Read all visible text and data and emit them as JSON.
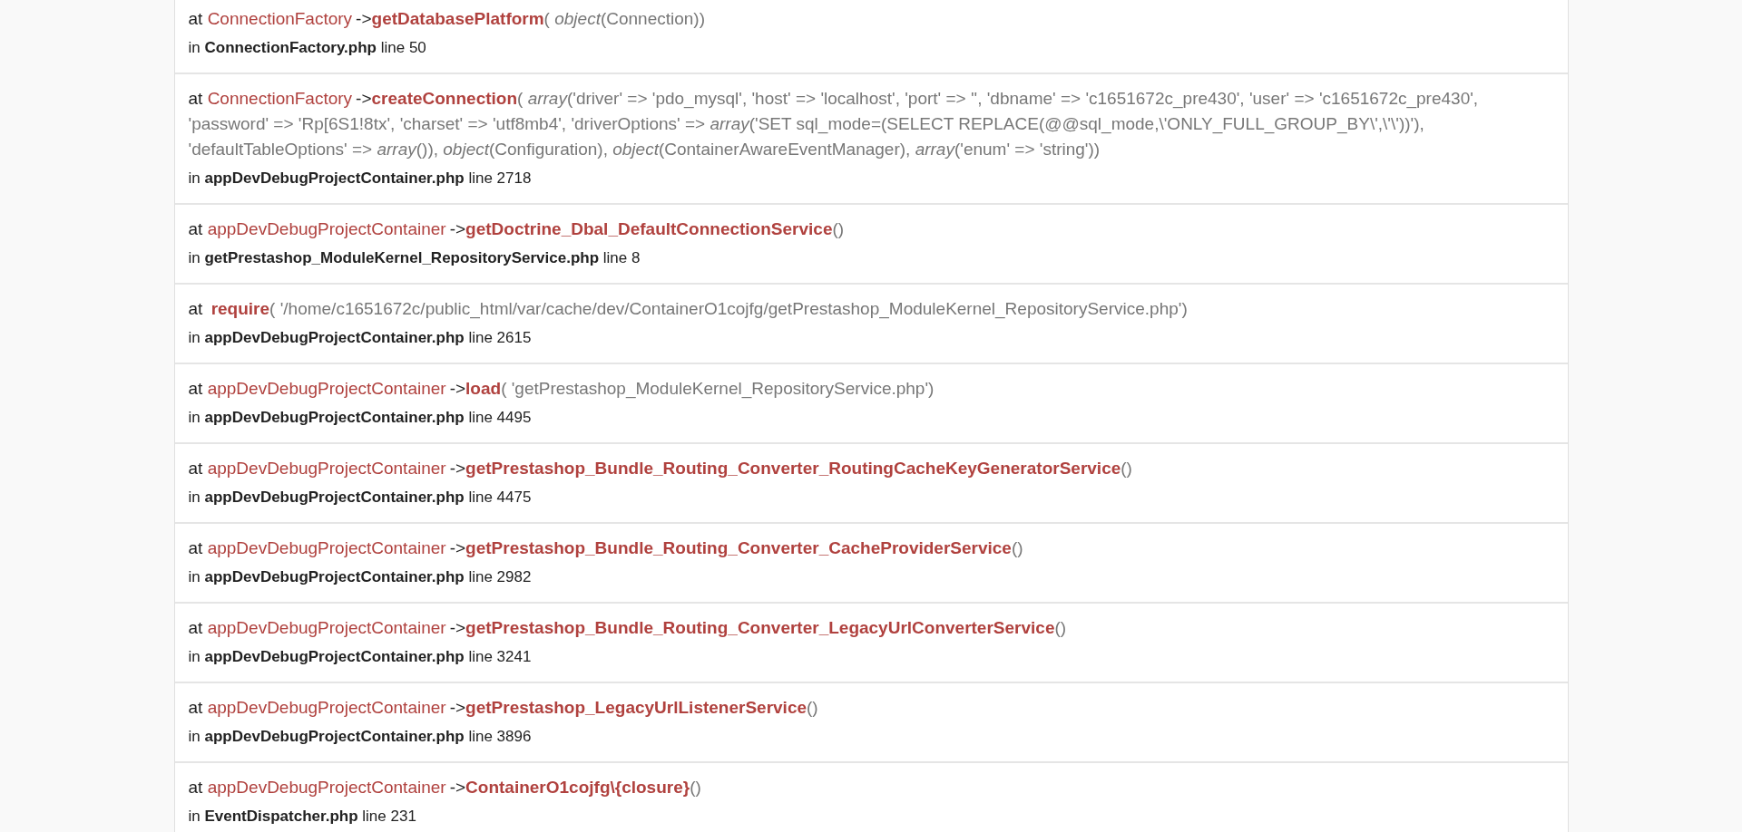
{
  "trace": [
    {
      "prefix": "at",
      "class": "ConnectionFactory",
      "operator": "->",
      "function": "getDatabasePlatform",
      "args": "( *object*(Connection))",
      "location": "in **ConnectionFactory.php** line 50"
    },
    {
      "prefix": "at",
      "class": "ConnectionFactory",
      "operator": "->",
      "function": "createConnection",
      "args": "( *array*('driver' => 'pdo_mysql', 'host' => 'localhost', 'port' => '', 'dbname' => 'c1651672c_pre430', 'user' => 'c1651672c_pre430', 'password' => 'Rp[6S1!8tx', 'charset' => 'utf8mb4', 'driverOptions' => *array*('SET sql_mode=(SELECT REPLACE(@@sql_mode,\\'ONLY_FULL_GROUP_BY\\',\\'\\'))'), 'defaultTableOptions' => *array*()), *object*(Configuration), *object*(ContainerAwareEventManager), *array*('enum' => 'string'))",
      "location": "in **appDevDebugProjectContainer.php** line 2718"
    },
    {
      "prefix": "at",
      "class": "appDevDebugProjectContainer",
      "operator": "->",
      "function": "getDoctrine_Dbal_DefaultConnectionService",
      "args": "()",
      "location": "in **getPrestashop_ModuleKernel_RepositoryService.php** line 8"
    },
    {
      "prefix": "at",
      "function": "require",
      "args": "( '/home/c1651672c/public_html/var/cache/dev/ContainerO1cojfg/getPrestashop_ModuleKernel_RepositoryService.php')",
      "location": "in **appDevDebugProjectContainer.php** line 2615"
    },
    {
      "prefix": "at",
      "class": "appDevDebugProjectContainer",
      "operator": "->",
      "function": "load",
      "args": "( 'getPrestashop_ModuleKernel_RepositoryService.php')",
      "location": "in **appDevDebugProjectContainer.php** line 4495"
    },
    {
      "prefix": "at",
      "class": "appDevDebugProjectContainer",
      "operator": "->",
      "function": "getPrestashop_Bundle_Routing_Converter_RoutingCacheKeyGeneratorService",
      "args": "()",
      "location": "in **appDevDebugProjectContainer.php** line 4475"
    },
    {
      "prefix": "at",
      "class": "appDevDebugProjectContainer",
      "operator": "->",
      "function": "getPrestashop_Bundle_Routing_Converter_CacheProviderService",
      "args": "()",
      "location": "in **appDevDebugProjectContainer.php** line 2982"
    },
    {
      "prefix": "at",
      "class": "appDevDebugProjectContainer",
      "operator": "->",
      "function": "getPrestashop_Bundle_Routing_Converter_LegacyUrlConverterService",
      "args": "()",
      "location": "in **appDevDebugProjectContainer.php** line 3241"
    },
    {
      "prefix": "at",
      "class": "appDevDebugProjectContainer",
      "operator": "->",
      "function": "getPrestashop_LegacyUrlListenerService",
      "args": "()",
      "location": "in **appDevDebugProjectContainer.php** line 3896"
    },
    {
      "prefix": "at",
      "class": "appDevDebugProjectContainer",
      "operator": "->",
      "function": "ContainerO1cojfg\\{closure}",
      "args": "()",
      "location": "in **EventDispatcher.php** line 231"
    }
  ]
}
